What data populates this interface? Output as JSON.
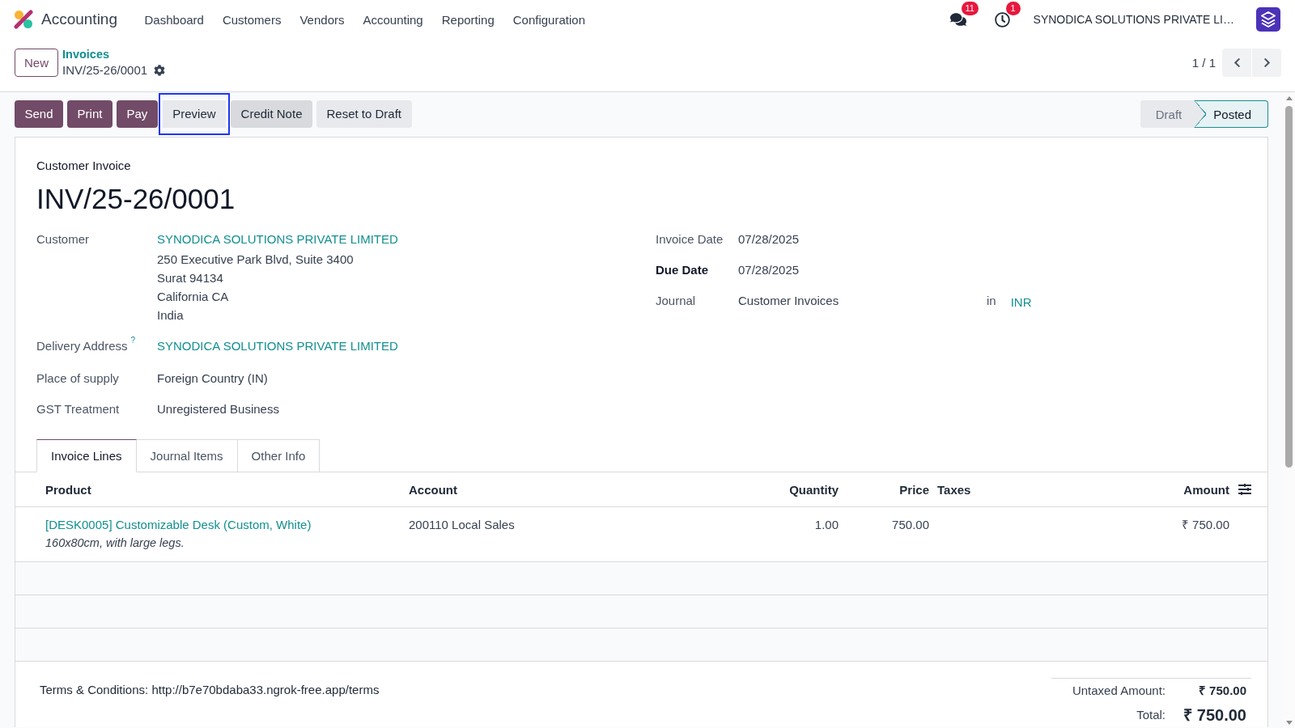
{
  "navbar": {
    "app_name": "Accounting",
    "menu": [
      "Dashboard",
      "Customers",
      "Vendors",
      "Accounting",
      "Reporting",
      "Configuration"
    ],
    "messages_badge": "11",
    "activities_badge": "1",
    "company": "SYNODICA SOLUTIONS PRIVATE LI…"
  },
  "control_panel": {
    "new_button": "New",
    "breadcrumb_parent": "Invoices",
    "breadcrumb_current": "INV/25-26/0001",
    "pager": "1 / 1"
  },
  "actions": [
    {
      "label": "Send",
      "kind": "primary",
      "focused": false,
      "hovered": false
    },
    {
      "label": "Print",
      "kind": "primary",
      "focused": false,
      "hovered": false
    },
    {
      "label": "Pay",
      "kind": "primary",
      "focused": false,
      "hovered": false
    },
    {
      "label": "Preview",
      "kind": "secondary",
      "focused": true,
      "hovered": false
    },
    {
      "label": "Credit Note",
      "kind": "secondary",
      "focused": false,
      "hovered": true
    },
    {
      "label": "Reset to Draft",
      "kind": "secondary",
      "focused": false,
      "hovered": false
    }
  ],
  "status": [
    {
      "label": "Draft",
      "selected": false
    },
    {
      "label": "Posted",
      "selected": true
    }
  ],
  "form": {
    "subtitle": "Customer Invoice",
    "title": "INV/25-26/0001",
    "left_fields": [
      {
        "label": "Customer",
        "kind": "link",
        "value": "SYNODICA SOLUTIONS PRIVATE LIMITED",
        "address": [
          "250 Executive Park Blvd, Suite 3400",
          "Surat 94134",
          "California CA",
          "India"
        ]
      },
      {
        "label": "Delivery Address",
        "help": "?",
        "kind": "link",
        "value": "SYNODICA SOLUTIONS PRIVATE LIMITED"
      },
      {
        "label": "Place of supply",
        "kind": "text",
        "value": "Foreign Country (IN)"
      },
      {
        "label": "GST Treatment",
        "kind": "text",
        "value": "Unregistered Business"
      }
    ],
    "right_fields": [
      {
        "label": "Invoice Date",
        "required": false,
        "value": "07/28/2025"
      },
      {
        "label": "Due Date",
        "required": true,
        "value": "07/28/2025"
      },
      {
        "label": "Journal",
        "required": false,
        "value": "Customer Invoices",
        "joiner": "in",
        "currency": "INR"
      }
    ]
  },
  "tabs": [
    {
      "label": "Invoice Lines",
      "selected": true
    },
    {
      "label": "Journal Items",
      "selected": false
    },
    {
      "label": "Other Info",
      "selected": false
    }
  ],
  "table": {
    "columns": [
      {
        "label": "Product",
        "kind": "text"
      },
      {
        "label": "Account",
        "kind": "text"
      },
      {
        "label": "Quantity",
        "kind": "number"
      },
      {
        "label": "Price",
        "kind": "number"
      },
      {
        "label": "Taxes",
        "kind": "text"
      },
      {
        "label": "Amount",
        "kind": "number"
      }
    ],
    "rows": [
      {
        "product": "[DESK0005] Customizable Desk (Custom, White)",
        "description": "160x80cm, with large legs.",
        "account": "200110 Local Sales",
        "quantity": "1.00",
        "price": "750.00",
        "amount": "₹ 750.00"
      }
    ]
  },
  "footer": {
    "terms": "Terms & Conditions: http://b7e70bdaba33.ngrok-free.app/terms",
    "totals": [
      {
        "label": "Untaxed Amount:",
        "value": "₹ 750.00",
        "kind": "subtotal"
      },
      {
        "label": "Total:",
        "value": "₹ 750.00",
        "kind": "grand"
      }
    ]
  }
}
